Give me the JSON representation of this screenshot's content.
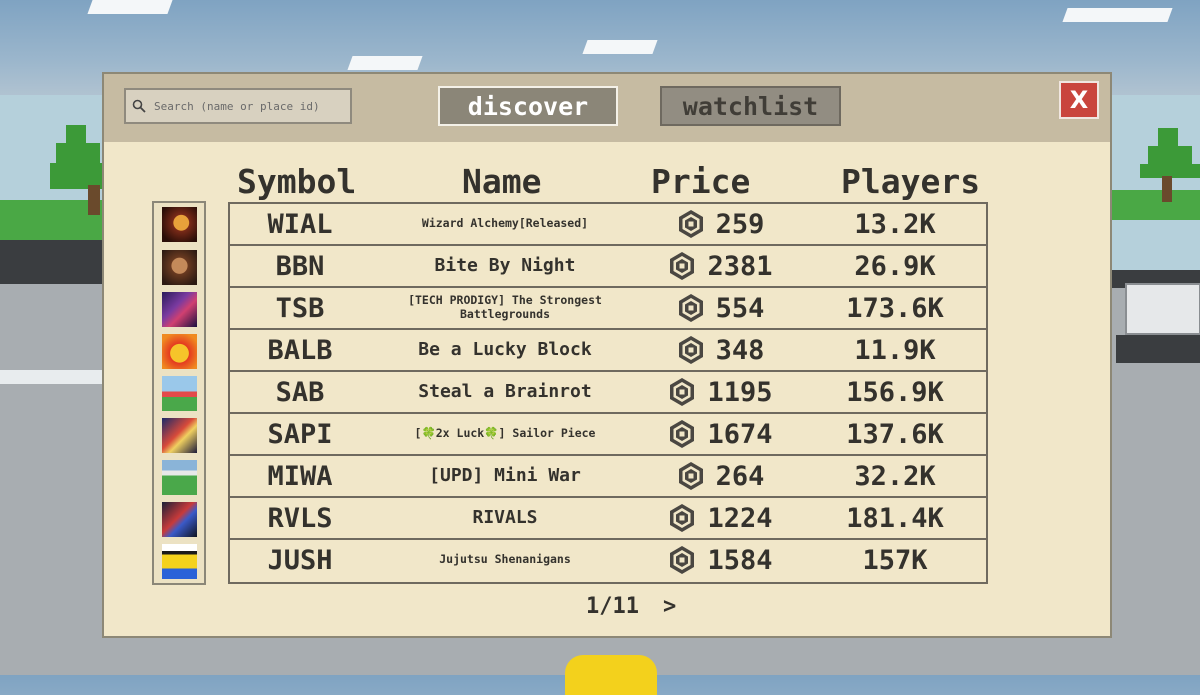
{
  "header": {
    "search_placeholder": "Search (name or place id)",
    "tabs": {
      "discover": "discover",
      "watchlist": "watchlist"
    },
    "close_label": "X",
    "active_tab": "discover"
  },
  "columns": {
    "symbol": "Symbol",
    "name": "Name",
    "price": "Price",
    "players": "Players"
  },
  "rows": [
    {
      "symbol": "WIAL",
      "name": "Wizard Alchemy[Released]",
      "price": "259",
      "players": "13.2K"
    },
    {
      "symbol": "BBN",
      "name": "Bite By Night",
      "price": "2381",
      "players": "26.9K"
    },
    {
      "symbol": "TSB",
      "name": "[TECH PRODIGY] The Strongest Battlegrounds",
      "price": "554",
      "players": "173.6K"
    },
    {
      "symbol": "BALB",
      "name": "Be a Lucky Block",
      "price": "348",
      "players": "11.9K"
    },
    {
      "symbol": "SAB",
      "name": "Steal a Brainrot",
      "price": "1195",
      "players": "156.9K"
    },
    {
      "symbol": "SAPI",
      "name": "[🍀2x Luck🍀] Sailor Piece",
      "price": "1674",
      "players": "137.6K"
    },
    {
      "symbol": "MIWA",
      "name": "[UPD] Mini War",
      "price": "264",
      "players": "32.2K"
    },
    {
      "symbol": "RVLS",
      "name": "RIVALS",
      "price": "1224",
      "players": "181.4K"
    },
    {
      "symbol": "JUSH",
      "name": "Jujutsu Shenanigans",
      "price": "1584",
      "players": "157K"
    }
  ],
  "pagination": {
    "label": "1/11",
    "next": ">"
  },
  "colors": {
    "panel": "#f1e7c9",
    "header": "#c6bba2",
    "close": "#c9453d",
    "text": "#34322d"
  },
  "icons": {
    "search": "search-icon",
    "currency": "robux-icon"
  }
}
